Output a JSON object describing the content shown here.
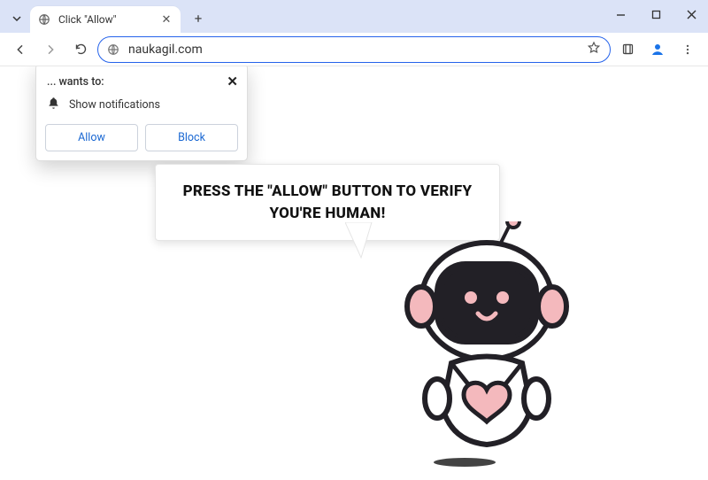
{
  "window": {
    "tab_title": "Click \"Allow\"",
    "new_tab_tooltip": "+"
  },
  "toolbar": {
    "url": "naukagil.com"
  },
  "permission_popup": {
    "origin_text": "... wants to:",
    "permission_label": "Show notifications",
    "allow_label": "Allow",
    "block_label": "Block"
  },
  "page": {
    "speech_text": "PRESS THE \"ALLOW\" BUTTON TO VERIFY YOU'RE HUMAN!"
  },
  "colors": {
    "robot_pink": "#f4b9bd",
    "robot_dark": "#222026"
  }
}
